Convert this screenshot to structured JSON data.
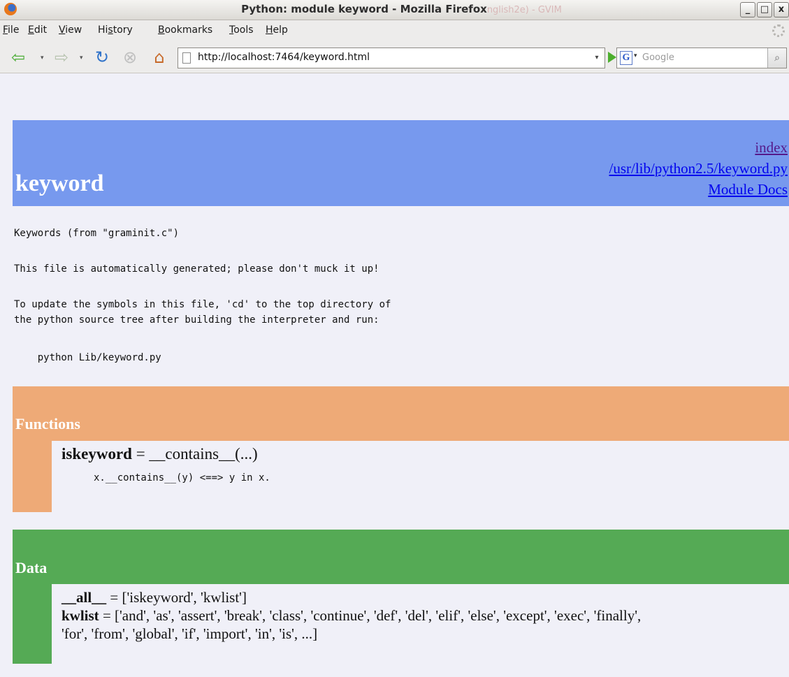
{
  "window": {
    "title": "Python: module keyword - Mozilla Firefox",
    "ghost_title": "nglish2e) - GVIM",
    "buttons": {
      "minimize": "_",
      "maximize": "□",
      "close": "x"
    }
  },
  "menu": {
    "items": [
      {
        "key": "F",
        "rest": "ile"
      },
      {
        "key": "E",
        "rest": "dit"
      },
      {
        "key": "V",
        "rest": "iew"
      },
      {
        "pre": "Hi",
        "key": "s",
        "rest": "tory"
      },
      {
        "key": "B",
        "rest": "ookmarks"
      },
      {
        "key": "T",
        "rest": "ools"
      },
      {
        "key": "H",
        "rest": "elp"
      }
    ]
  },
  "nav": {
    "back_icon": "back-arrow-icon",
    "forward_icon": "forward-arrow-icon",
    "reload_icon": "reload-icon",
    "stop_icon": "stop-icon",
    "home_icon": "home-icon",
    "url": "http://localhost:7464/keyword.html",
    "search_placeholder": "Google"
  },
  "page": {
    "module_name": "keyword",
    "links": {
      "index": "index",
      "source": "/usr/lib/python2.5/keyword.py",
      "docs": "Module Docs"
    },
    "doc_lines": [
      "Keywords (from \"graminit.c\")",
      "This file is automatically generated; please don't muck it up!",
      "To update the symbols in this file, 'cd' to the top directory of",
      "the python source tree after building the interpreter and run:",
      "    python Lib/keyword.py"
    ],
    "functions": {
      "title": "Functions",
      "decl_name": "iskeyword",
      "decl_rest": " = __contains__(...)",
      "doc": "x.__contains__(y) <==> y in x."
    },
    "data": {
      "title": "Data",
      "all_name": "__all__",
      "all_value": " = ['iskeyword', 'kwlist']",
      "kwlist_name": "kwlist",
      "kwlist_value_1": " = ['and', 'as', 'assert', 'break', 'class', 'continue', 'def', 'del', 'elif', 'else', 'except', 'exec', 'finally',",
      "kwlist_value_2": "'for', 'from', 'global', 'if', 'import', 'in', 'is', ...]"
    }
  },
  "colors": {
    "heading": "#7799ee",
    "functions": "#eeaa77",
    "data": "#55aa55",
    "background": "#f0f0f8"
  }
}
